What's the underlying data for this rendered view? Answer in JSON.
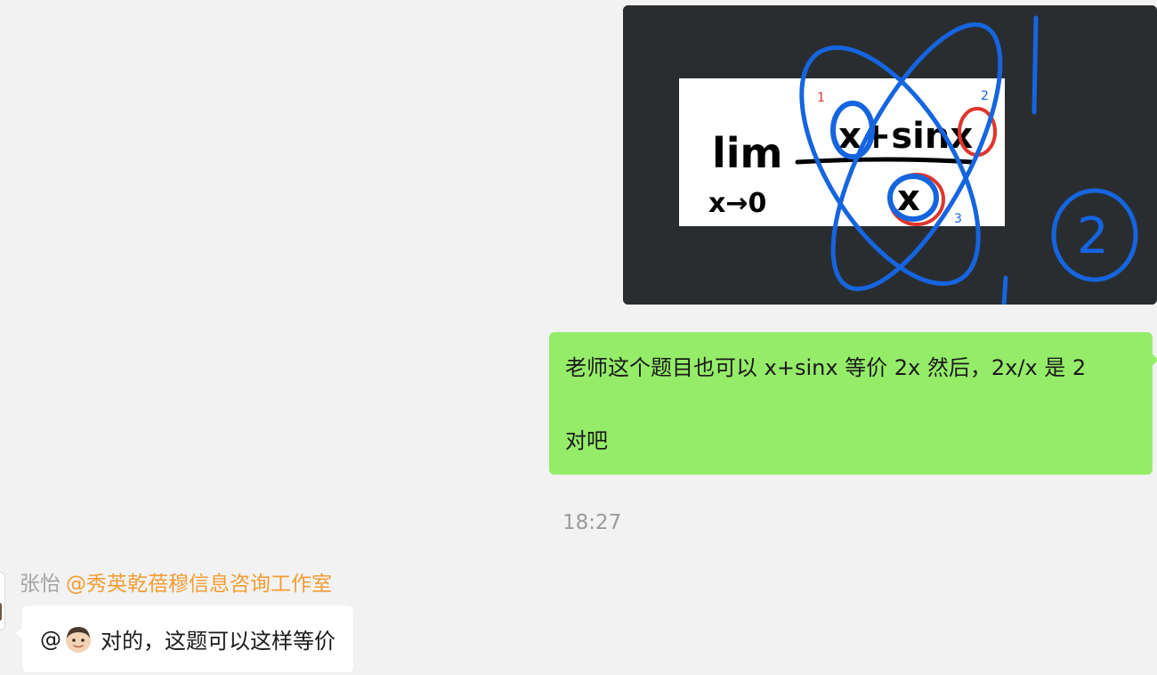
{
  "messages": {
    "image_message": {
      "formula": {
        "lim": "lim",
        "lim_subscript": "x→0",
        "numerator": "x+sinx",
        "denominator": "x"
      },
      "annotation_markers": [
        "1",
        "2",
        "3"
      ],
      "circled_number": "2"
    },
    "outgoing_text": {
      "line1": "老师这个题目也可以 x+sinx 等价 2x 然后，2x/x 是 2",
      "line2": "对吧"
    },
    "timestamp": "18:27",
    "incoming": {
      "sender_name": "张怡",
      "mention": "@秀英乾蓓穆信息咨询工作室",
      "at_symbol": "@",
      "text": "对的，这题可以这样等价",
      "avatar_icon": "person-emoji-icon"
    }
  },
  "colors": {
    "background": "#f2f2f2",
    "outgoing_bubble": "#95ec69",
    "incoming_bubble": "#ffffff",
    "mention": "#f59c32",
    "sender_name": "#a3a3a3",
    "timestamp": "#9a9a9a",
    "image_dark_bg": "#2a2d30",
    "annotation_blue": "#1565e0",
    "annotation_red": "#e0362c"
  }
}
